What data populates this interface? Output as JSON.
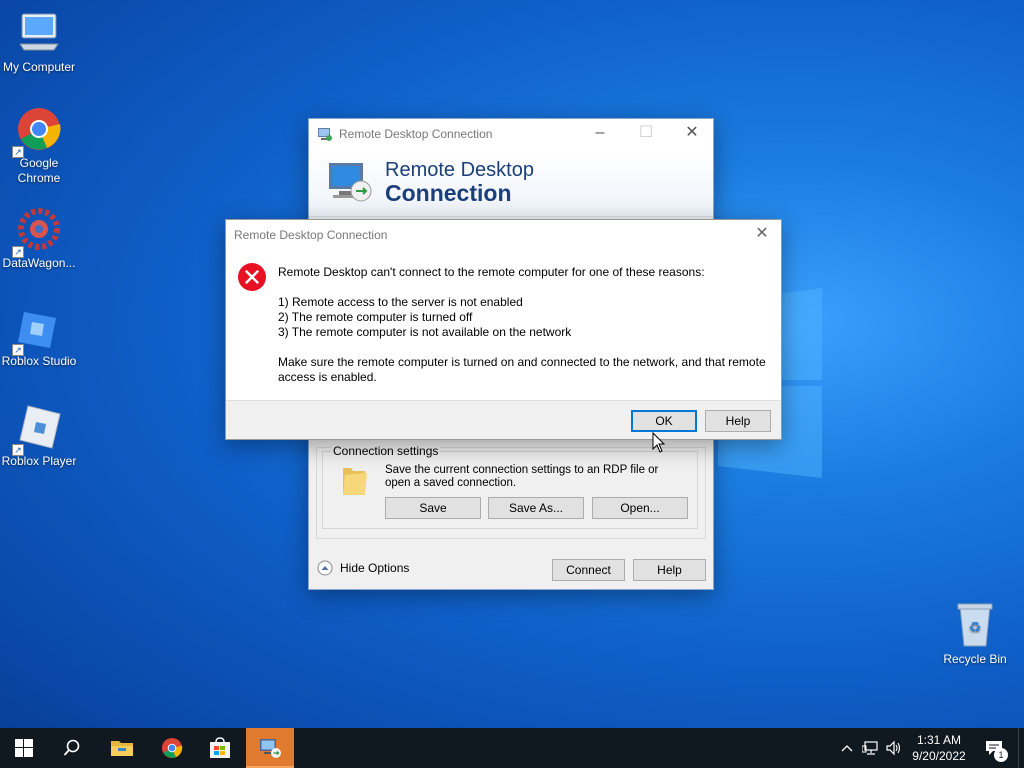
{
  "desktop": {
    "icons": [
      {
        "label": "My Computer"
      },
      {
        "label": "Google Chrome"
      },
      {
        "label": "DataWagon..."
      },
      {
        "label": "Roblox Studio"
      },
      {
        "label": "Roblox Player"
      },
      {
        "label": "Recycle Bin"
      }
    ]
  },
  "rdp_window": {
    "title": "Remote Desktop Connection",
    "banner_line1": "Remote Desktop",
    "banner_line2": "Connection",
    "connection_settings": {
      "legend": "Connection settings",
      "description": "Save the current connection settings to an RDP file or open a saved connection.",
      "save_label": "Save",
      "save_as_label": "Save As...",
      "open_label": "Open..."
    },
    "hide_options_label": "Hide Options",
    "connect_label": "Connect",
    "help_label": "Help"
  },
  "error_dialog": {
    "title": "Remote Desktop Connection",
    "intro": "Remote Desktop can't connect to the remote computer for one of these reasons:",
    "reasons": [
      "1) Remote access to the server is not enabled",
      "2) The remote computer is turned off",
      "3) The remote computer is not available on the network"
    ],
    "advice_line1": "Make sure the remote computer is turned on and connected to the network, and that remote",
    "advice_line2": "access is enabled.",
    "ok_label": "OK",
    "help_label": "Help"
  },
  "taskbar": {
    "time": "1:31 AM",
    "date": "9/20/2022",
    "notification_count": "1",
    "pinned": [
      "start-icon",
      "search-icon",
      "file-explorer-icon",
      "chrome-icon",
      "store-icon",
      "remote-desktop-icon"
    ]
  },
  "colors": {
    "accent": "#0078d7",
    "error_red": "#e81123",
    "taskbar_bg": "#101820",
    "active_app_highlight": "#e07a2f"
  }
}
